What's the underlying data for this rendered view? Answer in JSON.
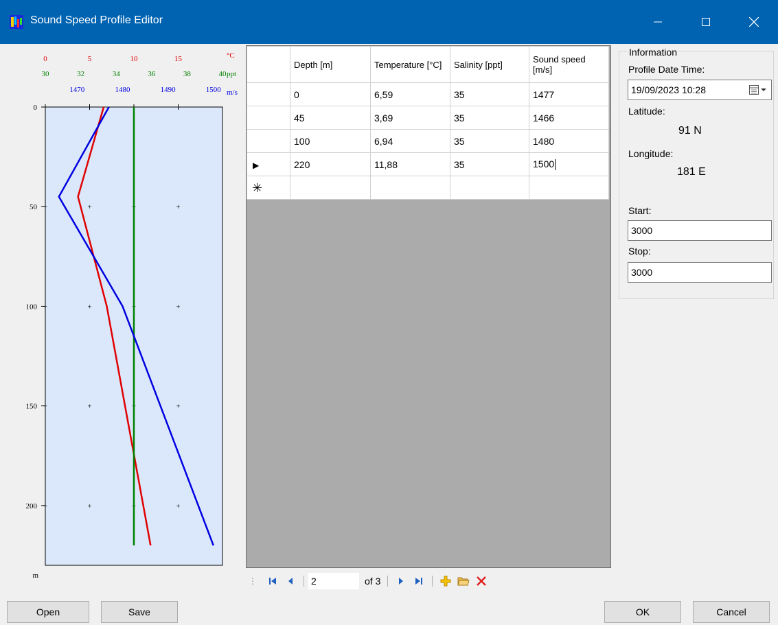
{
  "window": {
    "title": "Sound Speed Profile Editor",
    "title_bar_color": "#0063b1"
  },
  "chart_data": {
    "type": "line",
    "x_axes": [
      {
        "unit": "°C",
        "color": "#e00000",
        "ticks": [
          "0",
          "5",
          "10",
          "15"
        ],
        "range": [
          0,
          20
        ]
      },
      {
        "unit": "ppt",
        "color": "#008000",
        "ticks": [
          "30",
          "32",
          "34",
          "36",
          "38",
          "40"
        ],
        "range": [
          30,
          40
        ]
      },
      {
        "unit": "m/s",
        "color": "#0000e0",
        "ticks": [
          "1470",
          "1480",
          "1490",
          "1500"
        ],
        "range": [
          1463,
          1502
        ]
      }
    ],
    "y_axis": {
      "unit": "m",
      "ticks": [
        "0",
        "50",
        "100",
        "150",
        "200"
      ],
      "range": [
        0,
        230
      ],
      "inverted": true
    },
    "background": "#dbe8fb",
    "series": [
      {
        "color": "#e00000",
        "points": [
          [
            6.59,
            0
          ],
          [
            3.69,
            45
          ],
          [
            6.94,
            100
          ],
          [
            11.88,
            220
          ]
        ]
      },
      {
        "color": "#008000",
        "points": [
          [
            35,
            0
          ],
          [
            35,
            45
          ],
          [
            35,
            100
          ],
          [
            35,
            220
          ]
        ]
      },
      {
        "color": "#0000e0",
        "points": [
          [
            1477,
            0
          ],
          [
            1466,
            45
          ],
          [
            1480,
            100
          ],
          [
            1500,
            220
          ]
        ]
      }
    ]
  },
  "grid": {
    "columns": [
      "Depth [m]",
      "Temperature [°C]",
      "Salinity [ppt]",
      "Sound speed [m/s]"
    ],
    "rows": [
      [
        "0",
        "6,59",
        "35",
        "1477"
      ],
      [
        "45",
        "3,69",
        "35",
        "1466"
      ],
      [
        "100",
        "6,94",
        "35",
        "1480"
      ],
      [
        "220",
        "11,88",
        "35",
        "1500"
      ]
    ],
    "current_row_marker": "▶",
    "new_row_marker": "✳"
  },
  "navigator": {
    "position": "2",
    "of_label": "of 3"
  },
  "info": {
    "group_title": "Information",
    "date_label": "Profile Date Time:",
    "date_value": "19/09/2023 10:28",
    "latitude_label": "Latitude:",
    "latitude_value": "91 N",
    "longitude_label": "Longitude:",
    "longitude_value": "181 E",
    "start_label": "Start:",
    "start_value": "3000",
    "stop_label": "Stop:",
    "stop_value": "3000"
  },
  "buttons": {
    "open": "Open",
    "save": "Save",
    "ok": "OK",
    "cancel": "Cancel"
  }
}
